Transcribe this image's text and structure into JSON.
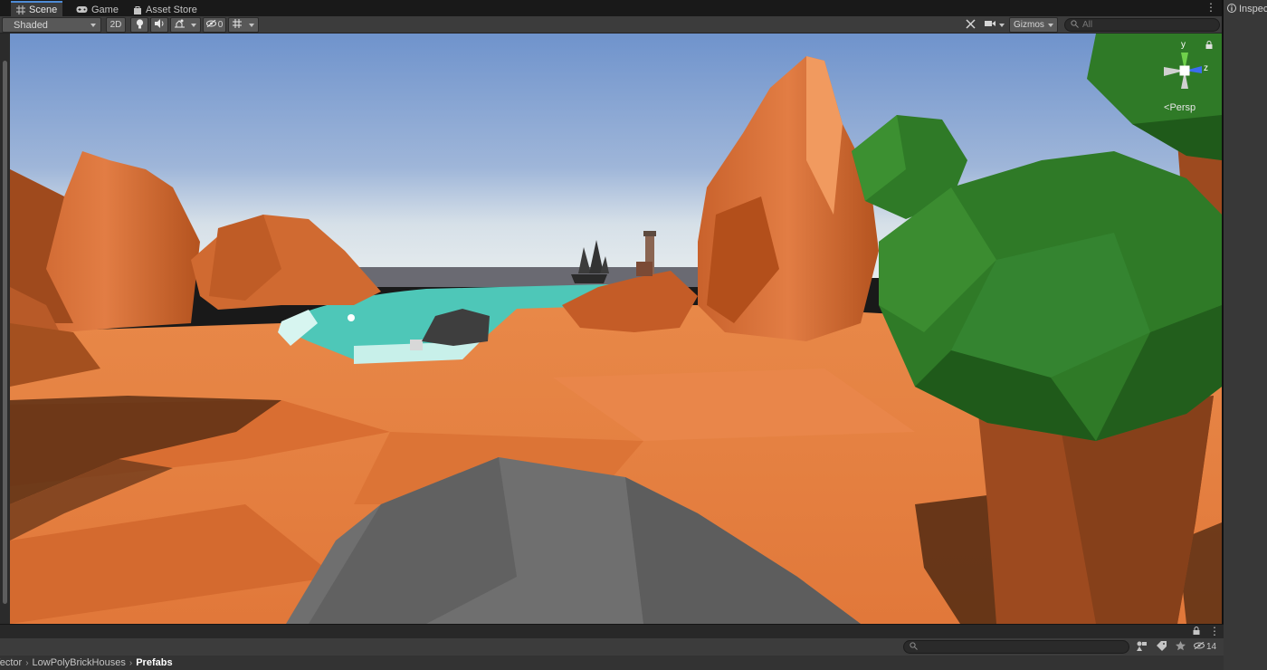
{
  "tabs": [
    {
      "label": "Scene",
      "icon": "grid-icon",
      "active": true
    },
    {
      "label": "Game",
      "icon": "gamepad-icon",
      "active": false
    },
    {
      "label": "Asset Store",
      "icon": "shopping-bag-icon",
      "active": false
    }
  ],
  "toolbar": {
    "draw_mode": "Shaded",
    "mode_2d": "2D",
    "hidden_count": "0",
    "gizmos_label": "Gizmos",
    "search_placeholder": "All"
  },
  "scene": {
    "projection_label": "Persp",
    "axis_y": "y",
    "axis_z": "z"
  },
  "inspector": {
    "tab_label": "Inspec"
  },
  "project": {
    "hidden_count": "14",
    "search_placeholder": "",
    "breadcrumb": [
      "Vector",
      "LowPolyBrickHouses",
      "Prefabs"
    ]
  },
  "colors": {
    "accent": "#4d8bd5",
    "sky_top": "#7a9ccf",
    "sand": "#e07a3a",
    "water": "#4ec7b8",
    "foliage": "#2f7a27"
  }
}
